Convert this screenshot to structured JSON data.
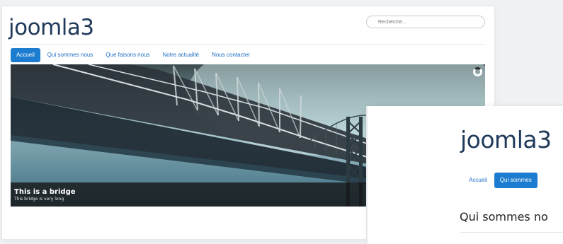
{
  "site": {
    "title": "joomla3",
    "search_placeholder": "Recherche...",
    "nav": [
      {
        "label": "Accueil",
        "active": true
      },
      {
        "label": "Qui sommes nous",
        "active": false
      },
      {
        "label": "Que faisons nous",
        "active": false
      },
      {
        "label": "Notre actualité",
        "active": false
      },
      {
        "label": "Nous contacter",
        "active": false
      }
    ],
    "slide": {
      "title": "This is a bridge",
      "subtitle": "This bridge is very long"
    }
  },
  "second_window": {
    "title": "joomla3",
    "nav": [
      {
        "label": "Accueil",
        "active": false
      },
      {
        "label": "Qui sommes",
        "active": true
      }
    ],
    "heading": "Qui sommes no"
  },
  "colors": {
    "accent": "#1c7ccf",
    "title": "#1f3a5a"
  }
}
